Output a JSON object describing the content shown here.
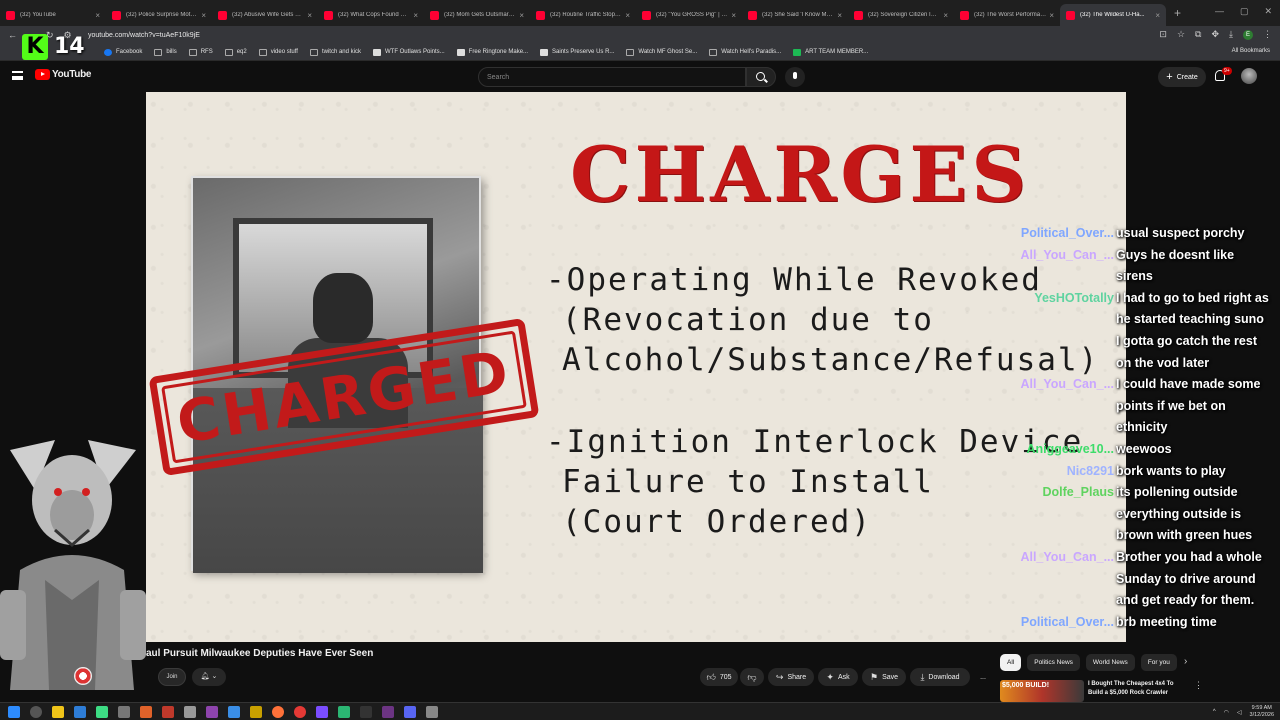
{
  "browser": {
    "tabs": [
      {
        "title": "(32) YouTube",
        "active": false
      },
      {
        "title": "(32) Police Surprise Moth...",
        "active": false
      },
      {
        "title": "(32) Abusive Wife Gets Hu...",
        "active": false
      },
      {
        "title": "(32) What Cops Found On...",
        "active": false
      },
      {
        "title": "(32) Mom Gets Outsmarte...",
        "active": false
      },
      {
        "title": "(32) Routine Traffic Stop Tu...",
        "active": false
      },
      {
        "title": "(32) \"You GROSS Pig\" | En...",
        "active": false
      },
      {
        "title": "(32) She Said 'I Know My R...",
        "active": false
      },
      {
        "title": "(32) Sovereign Citizen INV...",
        "active": false
      },
      {
        "title": "(32) The Worst Performanc...",
        "active": false
      },
      {
        "title": "(32) The Wildest U-Ha...",
        "active": true
      }
    ],
    "url": "youtube.com/watch?v=tuAeF10k9jE",
    "bookmarks": [
      {
        "label": "Facebook",
        "icon": "facebook-icon"
      },
      {
        "label": "bills",
        "icon": "folder-icon"
      },
      {
        "label": "RFS",
        "icon": "folder-icon"
      },
      {
        "label": "eq2",
        "icon": "folder-icon"
      },
      {
        "label": "video stuff",
        "icon": "folder-icon"
      },
      {
        "label": "twitch and kick",
        "icon": "folder-icon"
      },
      {
        "label": "WTF Outlaws Points...",
        "icon": "page-icon"
      },
      {
        "label": "Free Ringtone Make...",
        "icon": "page-icon"
      },
      {
        "label": "Saints Preserve Us R...",
        "icon": "page-icon"
      },
      {
        "label": "Watch MF Ghost Se...",
        "icon": "folder-icon"
      },
      {
        "label": "Watch Hell's Paradis...",
        "icon": "folder-icon"
      },
      {
        "label": "ART TEAM MEMBER...",
        "icon": "green-icon"
      }
    ],
    "all_bookmarks": "All Bookmarks"
  },
  "kick_overlay": {
    "logo": "K",
    "count": "14"
  },
  "youtube": {
    "logo_text": "YouTube",
    "search_placeholder": "Search",
    "create_label": "Create",
    "notif_badge": "9+",
    "video_title": "aul Pursuit Milwaukee Deputies Have Ever Seen",
    "join_label": "Join",
    "actions": {
      "likes": "705",
      "share": "Share",
      "ask": "Ask",
      "save": "Save",
      "download": "Download",
      "more": "..."
    },
    "chips": [
      "All",
      "Politics News",
      "World News",
      "For you"
    ],
    "recommendation": {
      "thumb_text": "$5,000 BUILD!",
      "title": "I Bought The Cheapest 4x4 To Build a $5,000 Rock Crawler"
    }
  },
  "video_frame": {
    "heading": "CHARGES",
    "stamp": "CHARGED",
    "charge_lines": [
      "-Operating While Revoked",
      "(Revocation due to",
      "Alcohol/Substance/Refusal)",
      "-Ignition Interlock Device",
      "Failure to Install",
      "(Court Ordered)"
    ]
  },
  "chat": [
    {
      "user": "Political_Over...",
      "msg": "usual suspect porchy",
      "color": "#7fa6ff"
    },
    {
      "user": "All_You_Can_...",
      "msg": "Guys he doesnt like",
      "color": "#c9a6ff"
    },
    {
      "user": "",
      "msg": "sirens",
      "color": "#ffffff"
    },
    {
      "user": "YesHOTotally",
      "msg": "I had to go to bed right as",
      "color": "#5fd3a0"
    },
    {
      "user": "",
      "msg": "he started teaching suno",
      "color": "#ffffff"
    },
    {
      "user": "",
      "msg": "I gotta go catch the rest",
      "color": "#ffffff"
    },
    {
      "user": "",
      "msg": "on the vod later",
      "color": "#ffffff"
    },
    {
      "user": "All_You_Can_...",
      "msg": "I could have made some",
      "color": "#c9a6ff"
    },
    {
      "user": "",
      "msg": "points if we bet on",
      "color": "#ffffff"
    },
    {
      "user": "",
      "msg": "ethnicity",
      "color": "#ffffff"
    },
    {
      "user": "Aniggeave10...",
      "msg": "weewoos",
      "color": "#3ddc6a"
    },
    {
      "user": "Nic8291",
      "msg": "bork wants to play",
      "color": "#9fb3ff"
    },
    {
      "user": "Dolfe_Plaus",
      "msg": "its pollening outside",
      "color": "#5fd35f"
    },
    {
      "user": "",
      "msg": "everything outside is",
      "color": "#ffffff"
    },
    {
      "user": "",
      "msg": "brown with green hues",
      "color": "#ffffff"
    },
    {
      "user": "All_You_Can_...",
      "msg": "Brother you had a whole",
      "color": "#c9a6ff"
    },
    {
      "user": "",
      "msg": "Sunday to drive around",
      "color": "#ffffff"
    },
    {
      "user": "",
      "msg": "and get ready for them.",
      "color": "#ffffff"
    },
    {
      "user": "Political_Over...",
      "msg": "brb meeting time",
      "color": "#7fa6ff"
    }
  ],
  "taskbar": {
    "time": "9:59 AM",
    "date": "3/12/2026"
  }
}
